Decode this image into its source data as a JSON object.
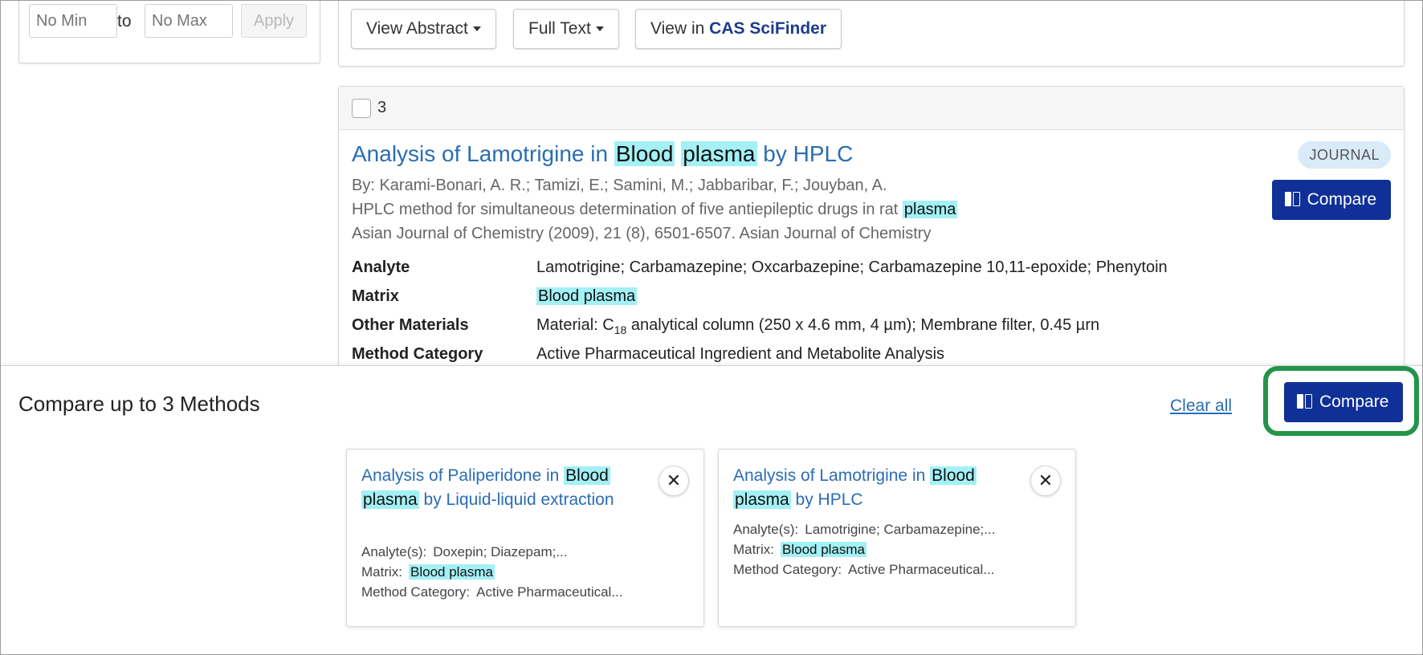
{
  "filter": {
    "min_placeholder": "No Min",
    "to_label": "to",
    "max_placeholder": "No Max",
    "apply_label": "Apply"
  },
  "result_toolbar": {
    "view_abstract": "View Abstract",
    "full_text": "Full Text",
    "view_in_prefix": "View in",
    "cas_brand": "CAS SciFinder"
  },
  "result3": {
    "number": "3",
    "title_prefix": "Analysis of Lamotrigine in",
    "title_hl1": "Blood",
    "title_hl2": "plasma",
    "title_suffix": "by HPLC",
    "badge": "JOURNAL",
    "compare_label": "Compare",
    "authors": "By: Karami-Bonari, A. R.; Tamizi, E.; Samini, M.; Jabbaribar, F.; Jouyban, A.",
    "subtitle_prefix": "HPLC method for simultaneous determination of five antiepileptic drugs in rat",
    "subtitle_hl": "plasma",
    "source": "Asian Journal of Chemistry (2009), 21 (8), 6501-6507. Asian Journal of Chemistry",
    "fields": {
      "analyte_label": "Analyte",
      "analyte_value": "Lamotrigine; Carbamazepine; Oxcarbazepine; Carbamazepine 10,11-epoxide; Phenytoin",
      "matrix_label": "Matrix",
      "matrix_value": "Blood plasma",
      "other_label": "Other Materials",
      "other_value_pre": "Material: C",
      "other_value_sub": "18",
      "other_value_post": " analytical column (250 x 4.6 mm, 4 µm); Membrane filter, 0.45 µrn",
      "method_label": "Method Category",
      "method_value": "Active Pharmaceutical Ingredient and Metabolite Analysis"
    }
  },
  "tray": {
    "title": "Compare up to 3 Methods",
    "clear_all": "Clear all",
    "compare_label": "Compare",
    "cards": [
      {
        "title_prefix": "Analysis of Paliperidone in",
        "title_hl1": "Blood",
        "title_hl2": "plasma",
        "title_suffix": "by Liquid-liquid extraction",
        "analyte_label": "Analyte(s):",
        "analyte_value": "Doxepin; Diazepam;...",
        "matrix_label": "Matrix:",
        "matrix_value": "Blood plasma",
        "method_label": "Method Category:",
        "method_value": "Active Pharmaceutical..."
      },
      {
        "title_prefix": "Analysis of Lamotrigine in",
        "title_hl1": "Blood",
        "title_hl2": "plasma",
        "title_suffix": "by HPLC",
        "analyte_label": "Analyte(s):",
        "analyte_value": "Lamotrigine; Carbamazepine;...",
        "matrix_label": "Matrix:",
        "matrix_value": "Blood plasma",
        "method_label": "Method Category:",
        "method_value": "Active Pharmaceutical..."
      }
    ],
    "close_glyph": "✕"
  },
  "colors": {
    "link_blue": "#2a6cb4",
    "compare_navy": "#0f3096",
    "highlight_cyan": "#a3f0f5",
    "focus_green": "#23944a",
    "badge_bg": "#d9ebf7"
  },
  "icons": {
    "compare": "compare-columns-icon",
    "caret": "caret-down-icon",
    "close": "close-icon"
  }
}
